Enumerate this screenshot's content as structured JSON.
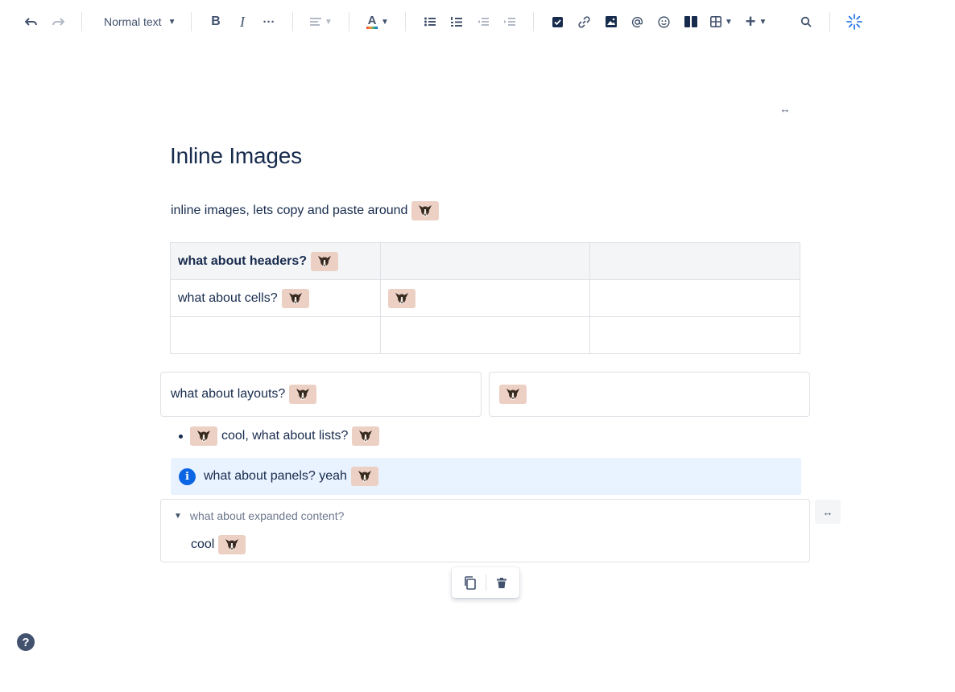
{
  "toolbar": {
    "text_style": "Normal text",
    "bold": "B",
    "italic": "I",
    "more": "···",
    "text_color": "A",
    "insert": "+",
    "accent": "#0c66e4"
  },
  "page": {
    "title": "Inline Images",
    "paragraph": "inline images, lets copy and paste around",
    "table": {
      "header": [
        "what about headers?",
        "",
        ""
      ],
      "rows": [
        [
          "what about cells?",
          "",
          ""
        ],
        [
          "",
          "",
          ""
        ]
      ]
    },
    "layout": {
      "col1": "what about layouts?",
      "col2": ""
    },
    "list_item": {
      "text": "cool, what about lists?"
    },
    "panel": {
      "text": "what about panels? yeah",
      "icon": "i"
    },
    "expand": {
      "title": "what about expanded content?",
      "body": "cool"
    }
  },
  "width_toggle": "↔",
  "help_icon": "?",
  "emoji_name": "dog-emoji"
}
